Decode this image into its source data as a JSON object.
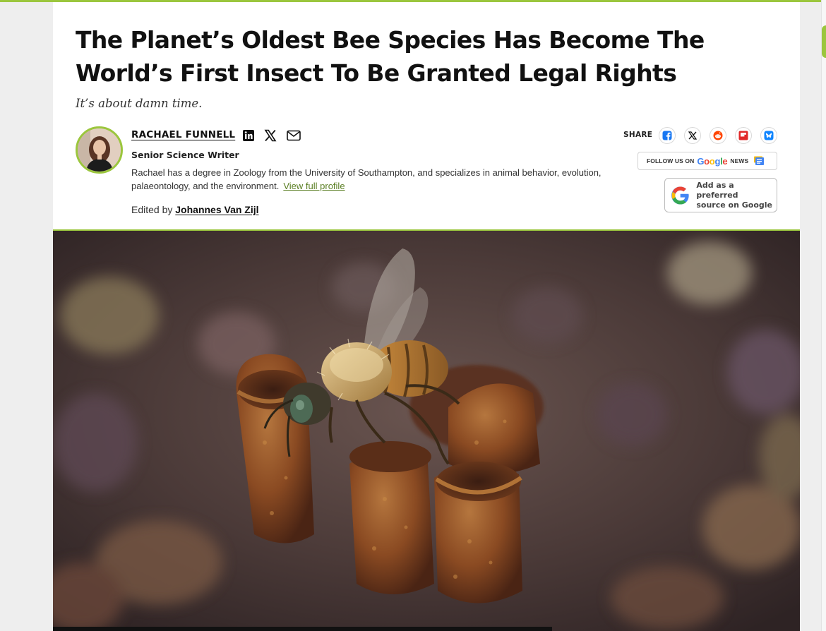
{
  "article": {
    "headline": "The Planet’s Oldest Bee Species Has Become The World’s First Insect To Be Granted Legal Rights",
    "dek": "It’s about damn time."
  },
  "author": {
    "name": "RACHAEL FUNNELL",
    "role": "Senior Science Writer",
    "bio": "Rachael has a degree in Zoology from the University of Southampton, and specializes in animal behavior, evolution, palaeontology, and the environment.",
    "profile_link": "View full profile",
    "social_icons": [
      "linkedin-icon",
      "x-icon",
      "mail-icon"
    ]
  },
  "editor": {
    "prefix": "Edited by",
    "name": "Johannes Van Zijl"
  },
  "share": {
    "label": "SHARE",
    "buttons": [
      "facebook-icon",
      "x-icon",
      "reddit-icon",
      "flipboard-icon",
      "bluesky-icon"
    ]
  },
  "google_news": {
    "prefix": "FOLLOW US ON",
    "brand": "Google",
    "suffix": "NEWS"
  },
  "google_preferred": {
    "line1": "Add as a preferred",
    "line2": "source on Google"
  },
  "colors": {
    "accent": "#9bc63d",
    "link": "#5b7f24",
    "facebook": "#1877f2",
    "reddit": "#ff4500",
    "flipboard": "#e12828",
    "bluesky": "#1185fe"
  },
  "hero_image": {
    "subject": "bee-on-honeycomb-photo"
  }
}
